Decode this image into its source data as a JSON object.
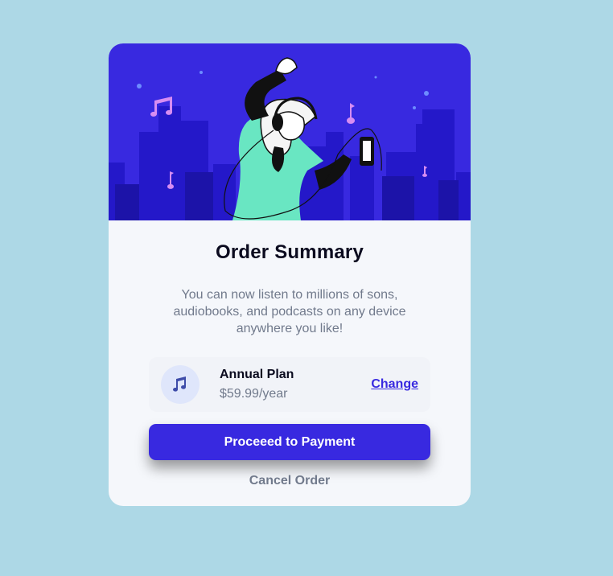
{
  "colors": {
    "page_background": "#add8e6",
    "card_background": "#f5f7fb",
    "accent": "#3829e0",
    "text_dark": "#0b0b1f",
    "text_muted": "#717a8c",
    "plan_background": "#f1f3f8"
  },
  "hero": {
    "icon": "music-illustration"
  },
  "summary": {
    "title": "Order Summary",
    "description": "You can now listen to millions of sons, audiobooks, and podcasts on any device anywhere you like!"
  },
  "plan": {
    "icon": "music-note-icon",
    "name": "Annual Plan",
    "price": "$59.99/year",
    "change_label": "Change"
  },
  "actions": {
    "proceed_label": "Proceeed to Payment",
    "cancel_label": "Cancel Order"
  }
}
